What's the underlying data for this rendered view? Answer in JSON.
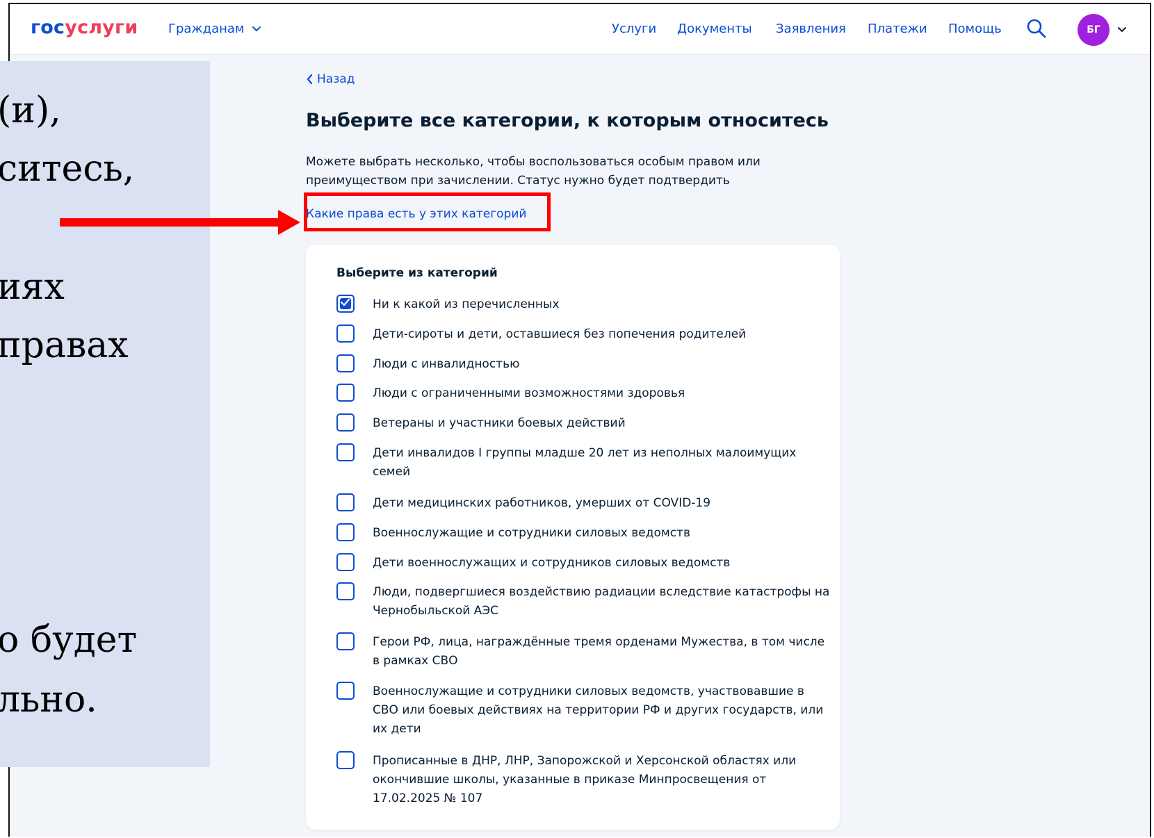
{
  "header": {
    "logo_part1": "гос",
    "logo_part2": "услуги",
    "citizen_menu": "Гражданам",
    "nav": [
      "Услуги",
      "Документы",
      "Заявления",
      "Платежи",
      "Помощь"
    ],
    "avatar_initials": "БГ"
  },
  "overlay": {
    "lines": [
      "(и),",
      "ситесь,",
      "иях",
      "правах",
      "о будет",
      "льно."
    ]
  },
  "main": {
    "back_label": "Назад",
    "title": "Выберите все категории, к которым относитесь",
    "description": "Можете выбрать несколько, чтобы воспользоваться особым правом или преимуществом при зачислении. Статус нужно будет подтвердить",
    "rights_link": "Какие права есть у этих категорий"
  },
  "categories": {
    "title": "Выберите из категорий",
    "options": [
      {
        "label": "Ни к какой из перечисленных",
        "checked": true
      },
      {
        "label": "Дети-сироты и дети, оставшиеся без попечения родителей",
        "checked": false
      },
      {
        "label": "Люди с инвалидностью",
        "checked": false
      },
      {
        "label": "Люди с ограниченными возможностями здоровья",
        "checked": false
      },
      {
        "label": "Ветераны и участники боевых действий",
        "checked": false
      },
      {
        "label": "Дети инвалидов I группы младше 20 лет из неполных малоимущих семей",
        "checked": false
      },
      {
        "label": "Дети медицинских работников, умерших от COVID-19",
        "checked": false
      },
      {
        "label": "Военнослужащие и сотрудники силовых ведомств",
        "checked": false
      },
      {
        "label": "Дети военнослужащих и сотрудников силовых ведомств",
        "checked": false
      },
      {
        "label": "Люди, подвергшиеся воздействию радиации вследствие катастрофы на Чернобыльской АЭС",
        "checked": false
      },
      {
        "label": "Герои РФ, лица, награждённые тремя орденами Мужества, в том числе в рамках СВО",
        "checked": false
      },
      {
        "label": "Военнослужащие и сотрудники силовых ведомств, участвовавшие в СВО или боевых действиях на территории РФ и других государств, или их дети",
        "checked": false
      },
      {
        "label": "Прописанные в ДНР, ЛНР, Запорожской и Херсонской областях или окончившие школы, указанные в приказе Минпросвещения от 17.02.2025 № 107",
        "checked": false
      }
    ]
  },
  "colors": {
    "accent": "#0d4cd3",
    "brand_red": "#ee3f58",
    "highlight": "#ff0000",
    "overlay_bg": "#d9e1f2",
    "avatar_bg": "#a020e0"
  }
}
